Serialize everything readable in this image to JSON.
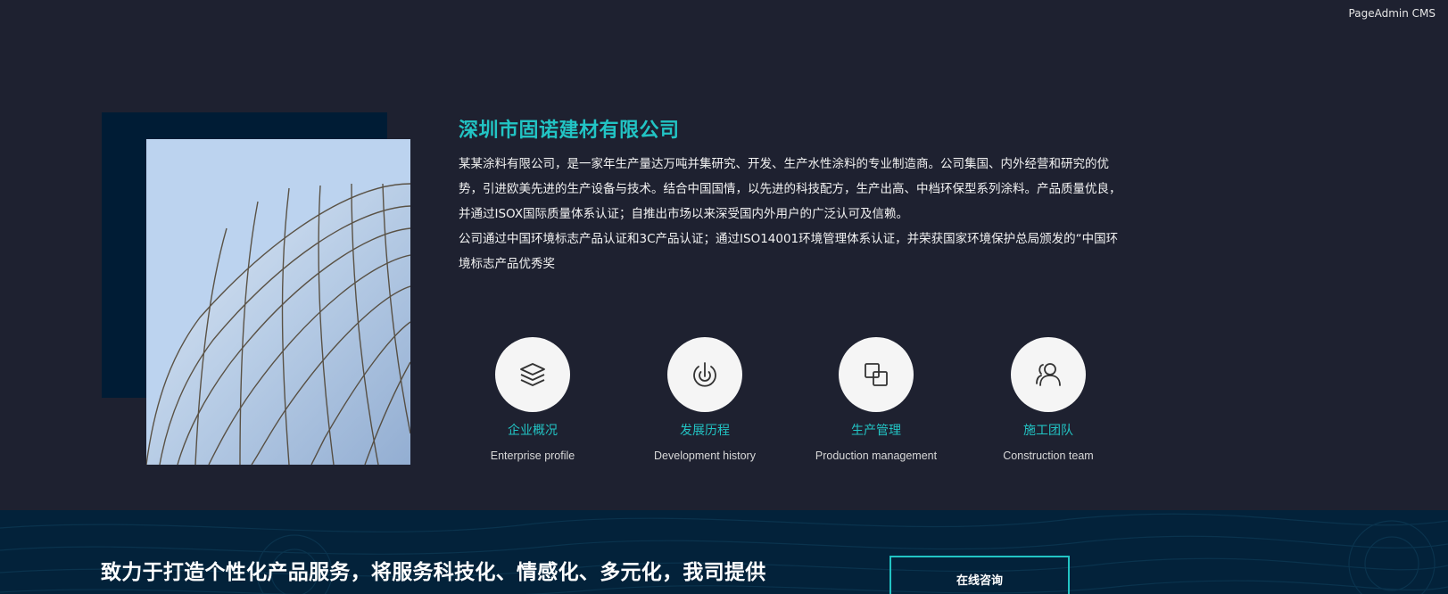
{
  "corner_brand": "PageAdmin CMS",
  "company": {
    "title": "深圳市固诺建材有限公司",
    "desc_lines": [
      "某某涂料有限公司，是一家年生产量达万吨并集研究、开发、生产水性涂料的专业制造商。公司集国、内外经营和研究的优",
      "势，引进欧美先进的生产设备与技术。结合中国国情，以先进的科技配方，生产出高、中档环保型系列涂料。产品质量优良，",
      "并通过ISOX国际质量体系认证；自推出市场以来深受国内外用户的广泛认可及信赖。",
      "公司通过中国环境标志产品认证和3C产品认证；通过ISO14001环境管理体系认证，并荣获国家环境保护总局颁发的“中国环",
      "境标志产品优秀奖"
    ],
    "image_alt": "building-glass-facade"
  },
  "features": [
    {
      "cn": "企业概况",
      "en": "Enterprise profile",
      "icon": "layers-icon"
    },
    {
      "cn": "发展历程",
      "en": "Development history",
      "icon": "power-history-icon"
    },
    {
      "cn": "生产管理",
      "en": "Production management",
      "icon": "overlap-squares-icon"
    },
    {
      "cn": "施工团队",
      "en": "Construction team",
      "icon": "team-users-icon"
    }
  ],
  "banner": {
    "text": "致力于打造个性化产品服务，将服务科技化、情感化、多元化，我司提供",
    "button": "在线咨询"
  },
  "colors": {
    "accent": "#22c4c4",
    "background": "#1e2130",
    "banner_bg": "#03223a",
    "image_backdrop": "#001c35"
  }
}
